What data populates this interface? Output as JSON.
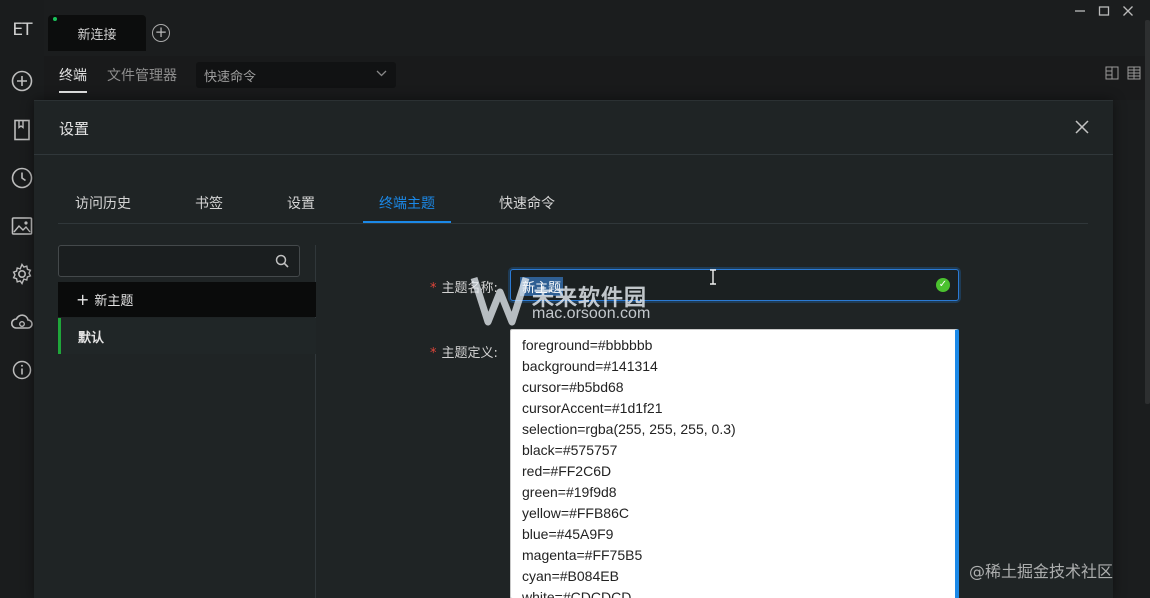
{
  "app": {
    "logo_text": "ET"
  },
  "tabs_bar": {
    "connection_tab": "新连接"
  },
  "subnav": {
    "terminal": "终端",
    "file_manager": "文件管理器",
    "quick_command_placeholder": "快速命令"
  },
  "rail_icons": [
    "add-circle-icon",
    "bookmark-icon",
    "history-clock-icon",
    "image-icon",
    "gear-icon",
    "cloud-sync-icon",
    "info-icon"
  ],
  "modal": {
    "title": "设置",
    "tabs": [
      "访问历史",
      "书签",
      "设置",
      "终端主题",
      "快速命令"
    ],
    "active_tab": "终端主题"
  },
  "sidebar": {
    "search_placeholder": "",
    "new_theme_label": "新主题",
    "themes": [
      "默认"
    ]
  },
  "form": {
    "name_label": "主题名称:",
    "name_value": "新主题",
    "definition_label": "主题定义:",
    "definition_lines": [
      "foreground=#bbbbbb",
      "background=#141314",
      "cursor=#b5bd68",
      "cursorAccent=#1d1f21",
      "selection=rgba(255, 255, 255, 0.3)",
      "black=#575757",
      "red=#FF2C6D",
      "green=#19f9d8",
      "yellow=#FFB86C",
      "blue=#45A9F9",
      "magenta=#FF75B5",
      "cyan=#B084EB",
      "white=#CDCDCD"
    ]
  },
  "watermark": {
    "title": "未来软件园",
    "url": "mac.orsoon.com"
  },
  "credit": "@稀土掘金技术社区",
  "colors": {
    "accent": "#1b89e8",
    "success": "#4bc12f",
    "required": "#e0463a",
    "active_item_bar": "#1fa63a"
  }
}
